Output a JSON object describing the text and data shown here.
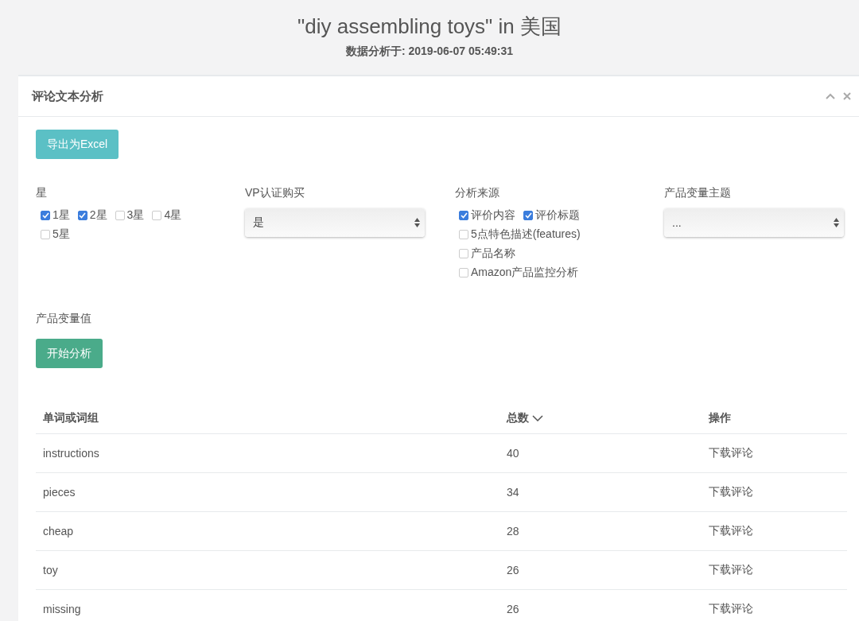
{
  "header": {
    "title": "\"diy assembling toys\" in 美国",
    "subtitle": "数据分析于: 2019-06-07 05:49:31"
  },
  "panel": {
    "title": "评论文本分析",
    "tools": [
      {
        "kind": "collapse"
      },
      {
        "kind": "close"
      }
    ],
    "export_button": "导出为Excel",
    "filters": [
      {
        "kind": "checks",
        "label": "星",
        "options": [
          {
            "label": "1星",
            "checked": true
          },
          {
            "label": "2星",
            "checked": true
          },
          {
            "label": "3星",
            "checked": false
          },
          {
            "label": "4星",
            "checked": false
          },
          {
            "label": "5星",
            "checked": false
          }
        ]
      },
      {
        "kind": "select",
        "label": "VP认证购买",
        "value": "是"
      },
      {
        "kind": "checks",
        "label": "分析来源",
        "options": [
          {
            "label": "评价内容",
            "checked": true
          },
          {
            "label": "评价标题",
            "checked": true
          },
          {
            "label": "5点特色描述(features)",
            "checked": false
          },
          {
            "label": "产品名称",
            "checked": false
          },
          {
            "label": "Amazon产品监控分析",
            "checked": false
          }
        ]
      },
      {
        "kind": "select",
        "label": "产品变量主题",
        "value": "..."
      }
    ],
    "variant_label": "产品变量值",
    "start_button": "开始分析",
    "table": {
      "columns": [
        {
          "label": "单词或词组",
          "sorted": false
        },
        {
          "label": "总数",
          "sorted": true
        },
        {
          "label": "操作",
          "sorted": false
        }
      ],
      "rows": [
        {
          "word": "instructions",
          "count": "40",
          "action": "下载评论"
        },
        {
          "word": "pieces",
          "count": "34",
          "action": "下载评论"
        },
        {
          "word": "cheap",
          "count": "28",
          "action": "下载评论"
        },
        {
          "word": "toy",
          "count": "26",
          "action": "下载评论"
        },
        {
          "word": "missing",
          "count": "26",
          "action": "下载评论"
        }
      ]
    }
  }
}
